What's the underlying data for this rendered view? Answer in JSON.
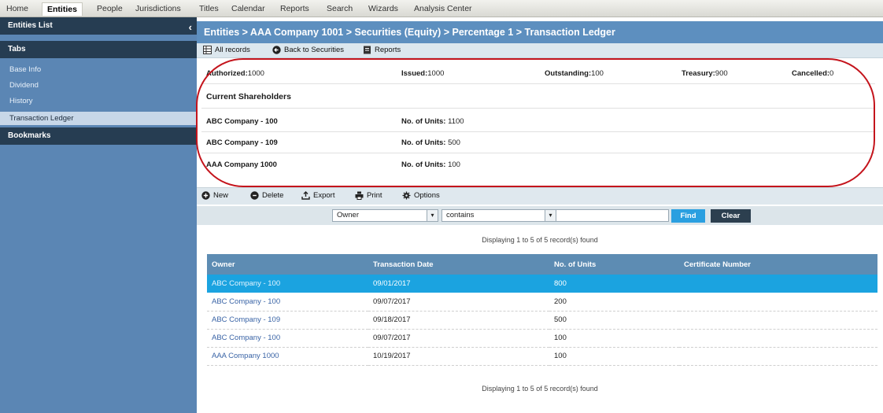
{
  "nav": {
    "items": [
      "Home",
      "Entities",
      "People",
      "Jurisdictions",
      "Titles",
      "Calendar",
      "Reports",
      "Search",
      "Wizards",
      "Analysis Center"
    ],
    "active": "Entities"
  },
  "sidebar": {
    "entities_list": "Entities List",
    "tabs_header": "Tabs",
    "links": [
      "Base Info",
      "Dividend",
      "History",
      "Transaction Ledger"
    ],
    "active_link": "Transaction Ledger",
    "bookmarks_header": "Bookmarks",
    "collapse_icon": "chevron-left-icon"
  },
  "breadcrumb": "Entities > AAA Company 1001 > Securities (Equity) > Percentage 1 > Transaction Ledger",
  "toolbar1": {
    "all_records": "All records",
    "back": "Back to Securities",
    "reports": "Reports"
  },
  "summary": {
    "authorized_label": "Authorized:",
    "authorized": "1000",
    "issued_label": "Issued:",
    "issued": "1000",
    "outstanding_label": "Outstanding:",
    "outstanding": "100",
    "treasury_label": "Treasury:",
    "treasury": "900",
    "cancelled_label": "Cancelled:",
    "cancelled": "0"
  },
  "shareholders": {
    "title": "Current Shareholders",
    "units_label": "No. of Units:",
    "rows": [
      {
        "name": "ABC Company - 100",
        "units": "1100"
      },
      {
        "name": "ABC Company - 109",
        "units": "500"
      },
      {
        "name": "AAA Company 1000",
        "units": "100"
      }
    ]
  },
  "toolbar2": {
    "new": "New",
    "delete": "Delete",
    "export": "Export",
    "print": "Print",
    "options": "Options"
  },
  "filter": {
    "field": "Owner",
    "operator": "contains",
    "value": "",
    "find": "Find",
    "clear": "Clear"
  },
  "display_text": "Displaying 1 to 5 of 5 record(s) found",
  "table": {
    "headers": [
      "Owner",
      "Transaction Date",
      "No. of Units",
      "Certificate Number"
    ],
    "rows": [
      {
        "owner": "ABC Company - 100",
        "date": "09/01/2017",
        "units": "800",
        "cert": ""
      },
      {
        "owner": "ABC Company - 100",
        "date": "09/07/2017",
        "units": "200",
        "cert": ""
      },
      {
        "owner": "ABC Company - 109",
        "date": "09/18/2017",
        "units": "500",
        "cert": ""
      },
      {
        "owner": "ABC Company - 100",
        "date": "09/07/2017",
        "units": "100",
        "cert": ""
      },
      {
        "owner": "AAA Company 1000",
        "date": "10/19/2017",
        "units": "100",
        "cert": ""
      }
    ]
  },
  "colors": {
    "highlight": "#c4141c",
    "selected_row": "#1ba3e0",
    "header_blue": "#5d8fbf",
    "sidebar_blue": "#5b86b4"
  }
}
